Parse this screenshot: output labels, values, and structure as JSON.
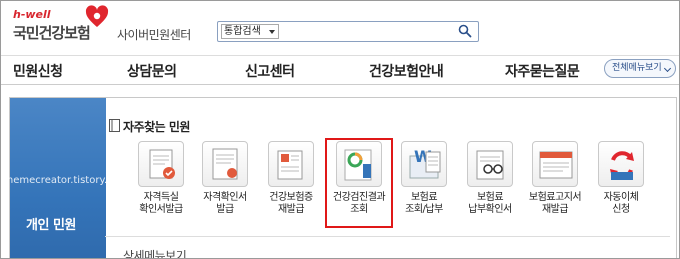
{
  "header": {
    "logo_small": "h-well",
    "logo_main": "국민건강보험",
    "logo_sub": "사이버민원센터",
    "search_select": "통합검색",
    "search_placeholder": ""
  },
  "nav": {
    "items": [
      "민원신청",
      "상담문의",
      "신고센터",
      "건강보험안내",
      "자주묻는질문"
    ],
    "all_menu": "전체메뉴보기"
  },
  "side": {
    "label": "개인 민원"
  },
  "watermark": "themecreator.tistory.com",
  "section": {
    "title": "자주찾는 민원",
    "tiles": [
      {
        "line1": "자격득실",
        "line2": "확인서발급"
      },
      {
        "line1": "자격확인서",
        "line2": "발급"
      },
      {
        "line1": "건강보험증",
        "line2": "재발급"
      },
      {
        "line1": "건강검진결과",
        "line2": "조회"
      },
      {
        "line1": "보험료",
        "line2": "조회/납부"
      },
      {
        "line1": "보험료",
        "line2": "납부확인서"
      },
      {
        "line1": "보험료고지서",
        "line2": "재발급"
      },
      {
        "line1": "자동이체",
        "line2": "신청"
      }
    ]
  },
  "section2": {
    "title": "상세메뉴보기"
  },
  "colors": {
    "brand_red": "#d8262e",
    "side_blue": "#3474b9",
    "highlight": "#e01818"
  }
}
